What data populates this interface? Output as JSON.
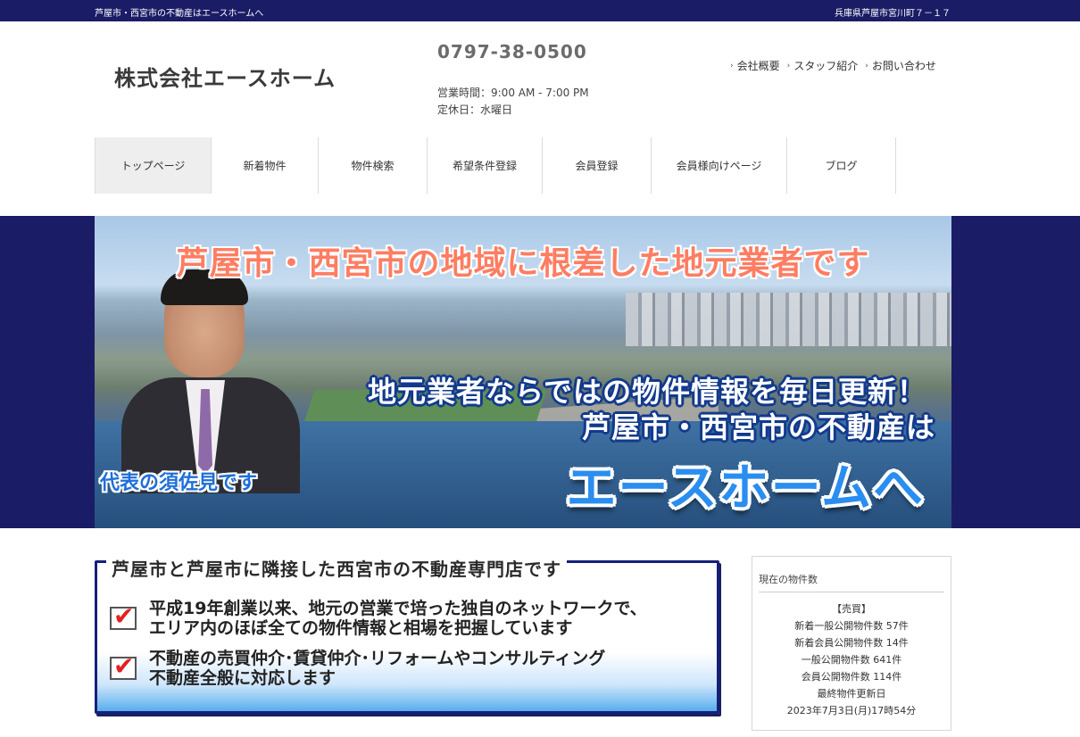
{
  "topbar": {
    "left_text": "芦屋市・西宮市の不動産はエースホームへ",
    "right_text": "兵庫県芦屋市宮川町７－１７"
  },
  "header": {
    "company_name": "株式会社エースホーム",
    "phone": "0797-38-0500",
    "hours": "営業時間：9:00 AM - 7:00 PM",
    "holiday": "定休日：水曜日",
    "links": [
      {
        "label": "会社概要"
      },
      {
        "label": "スタッフ紹介"
      },
      {
        "label": "お問い合わせ"
      }
    ]
  },
  "nav": {
    "items": [
      {
        "label": "トップページ"
      },
      {
        "label": "新着物件"
      },
      {
        "label": "物件検索"
      },
      {
        "label": "希望条件登録"
      },
      {
        "label": "会員登録"
      },
      {
        "label": "会員様向けページ"
      },
      {
        "label": "ブログ"
      }
    ],
    "active_index": 0
  },
  "hero": {
    "headline": "芦屋市・西宮市の地域に根差した地元業者です",
    "line2": "地元業者ならではの物件情報を毎日更新！",
    "line3": "芦屋市・西宮市の不動産は",
    "line4": "エースホームへ",
    "caption": "代表の須佐見です"
  },
  "intro": {
    "heading": "芦屋市と芦屋市に隣接した西宮市の不動産専門店です",
    "points": [
      {
        "line1": "平成19年創業以来、地元の営業で培った独自のネットワークで、",
        "line2": "エリア内のほぼ全ての物件情報と相場を把握しています"
      },
      {
        "line1": "不動産の売買仲介･賃貸仲介･リフォームやコンサルティング",
        "line2": "不動産全般に対応します"
      }
    ]
  },
  "stock": {
    "title": "現在の物件数",
    "section": "【売買】",
    "new_general": "新着一般公開物件数 57件",
    "new_member": "新着会員公開物件数 14件",
    "general": "一般公開物件数 641件",
    "member": "会員公開物件数 114件",
    "updated_label": "最終物件更新日",
    "updated_date": "2023年7月3日(月)17時54分"
  },
  "colors": {
    "navy": "#1b1c66",
    "headline_red": "#ff7d62",
    "accent_blue": "#2a8ef0"
  }
}
